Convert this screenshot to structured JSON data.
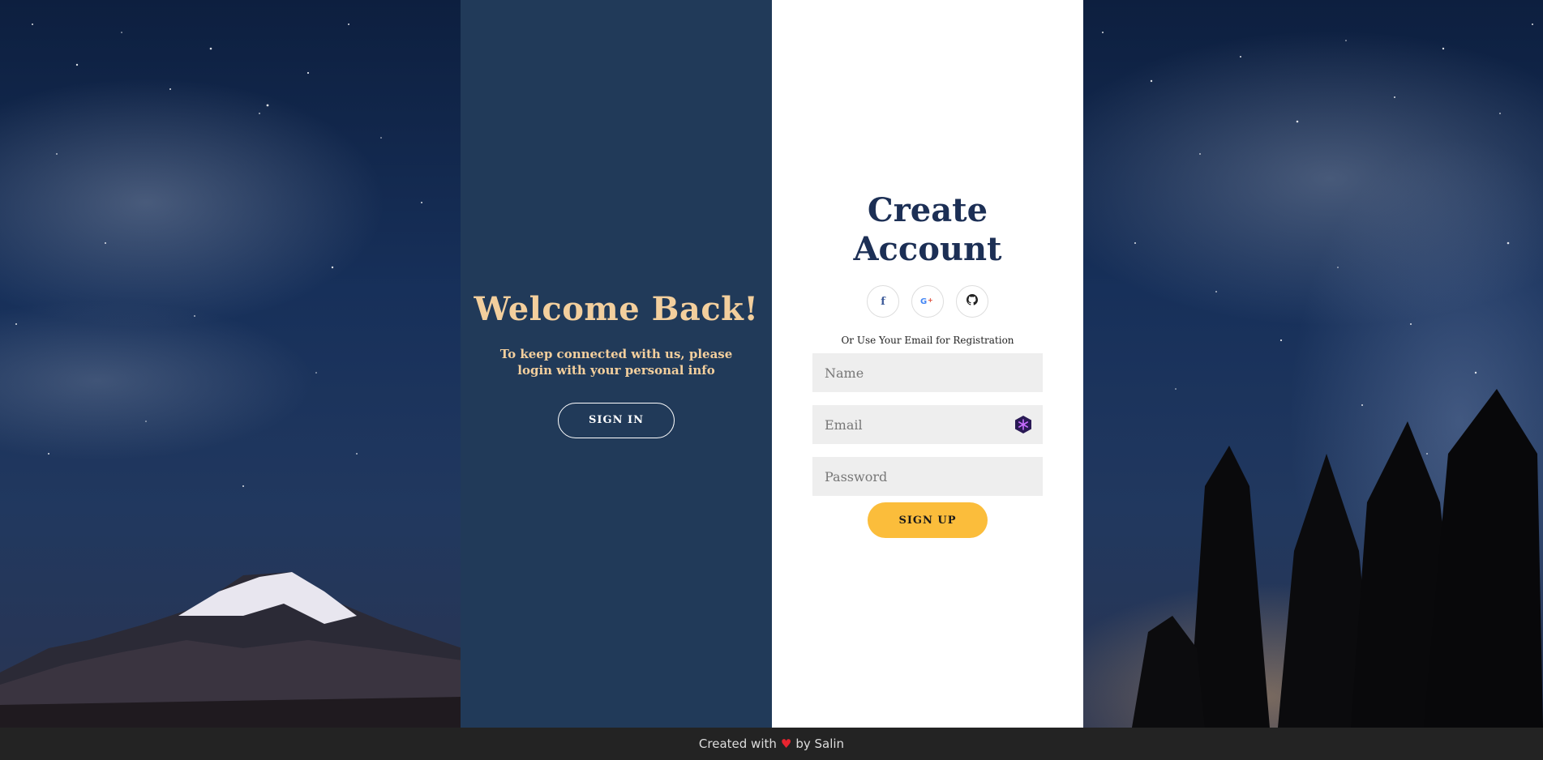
{
  "welcome": {
    "title": "Welcome Back!",
    "text": "To keep connected with us, please login with your personal info",
    "signin_label": "SIGN IN"
  },
  "signup": {
    "title_line1": "Create",
    "title_line2": "Account",
    "socials": [
      {
        "icon": "facebook-icon",
        "glyph": "f",
        "color": "#3b5998"
      },
      {
        "icon": "google-plus-icon",
        "glyph": "G+",
        "color": "#dd4b39"
      },
      {
        "icon": "github-icon",
        "glyph": "◉",
        "color": "#222222"
      }
    ],
    "or_text": "Or Use Your Email for Registration",
    "name_placeholder": "Name",
    "email_placeholder": "Email",
    "password_placeholder": "Password",
    "signup_label": "SIGN UP"
  },
  "footer": {
    "prefix": "Created with",
    "heart": "♥",
    "suffix": "by Salin"
  },
  "colors": {
    "left_panel": "#213a59",
    "accent_gold": "#f3cf9d",
    "button_yellow": "#fbbd3b",
    "title_navy": "#1c2f55"
  }
}
